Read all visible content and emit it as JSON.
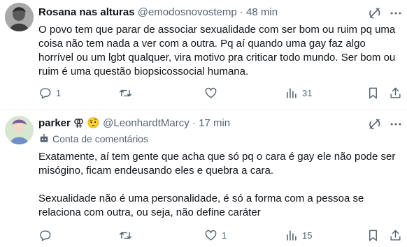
{
  "tweets": [
    {
      "display_name": "Rosana nas alturas",
      "handle": "@emodosnovostemp",
      "separator": "·",
      "time": "48 min",
      "text": "O povo tem que parar de associar  sexualidade com ser bom ou ruim pq uma coisa não tem nada a ver com a outra. Pq aí quando uma gay faz algo horrível ou um lgbt qualquer, vira motivo pra criticar todo mundo. Ser bom ou ruim é uma questão biopsicossocial humana.",
      "replies": "1",
      "retweets": "",
      "likes": "",
      "views": "31",
      "avatar_color": "#9a9a9a"
    },
    {
      "display_name": "parker",
      "name_emoji": "⚢ 🤨",
      "handle": "@LeonhardtMarcy",
      "separator": "·",
      "time": "17 min",
      "badge_text": "Conta de comentários",
      "paragraphs": [
        "Exatamente, aí tem gente que acha que só pq o cara é gay ele não pode ser misógino, ficam endeusando eles e quebra a cara.",
        "Sexualidade não é uma personalidade, é só a forma com a pessoa se relaciona com outra, ou seja, não define caráter"
      ],
      "replies": "",
      "retweets": "",
      "likes": "1",
      "views": "15",
      "avatar_color": "#c8dcc0"
    }
  ],
  "colors": {
    "text": "#0f1419",
    "muted": "#536471",
    "divider": "#eff3f4"
  },
  "icons": [
    "grok-icon",
    "more-icon",
    "reply-icon",
    "retweet-icon",
    "like-icon",
    "views-icon",
    "bookmark-icon",
    "share-icon",
    "robot-icon"
  ]
}
